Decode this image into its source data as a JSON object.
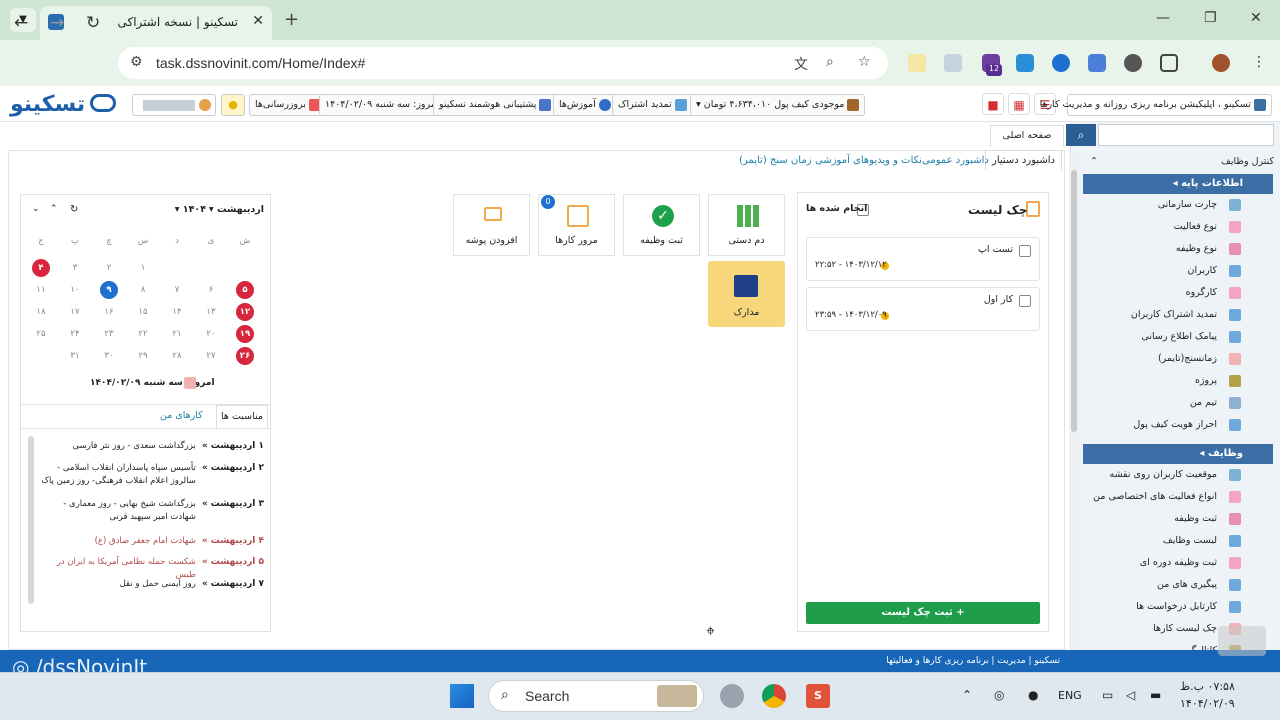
{
  "browser": {
    "tab_title": "تسکینو | نسخه اشتراکی",
    "url": "task.dssnovinit.com/Home/Index#",
    "ext_badge": "12"
  },
  "app": {
    "logo": "تسکینو",
    "chips": {
      "wallet": "موجودی کیف پول ۴،۶۳۴،۰۱۰ تومان",
      "renew": "تمدید اشتراک",
      "tutorials": "آموزش‌ها",
      "support": "پشتیبانی هوشمند تسکینو",
      "today": "امروز: سه شنبه ۱۴۰۴/۰۲/۰۹",
      "updates": "بروزرسانی‌ها"
    },
    "app_title": "تسکینو ، اپلیکیشن برنامه ریزی روزانه و مدیریت کارها",
    "breadcrumb": "صفحه اصلی",
    "tabs": [
      "داشبورد دستیار",
      "داشبورد عمومی",
      "نکات و ویدیوهای آموزشی",
      "زمان سنج (تایمر)"
    ]
  },
  "sidebar": {
    "title": "کنترل وظایف",
    "section1": "اطلاعات پایه",
    "items1": [
      "چارت سازمانی",
      "نوع فعالیت",
      "نوع وظیفه",
      "کاربران",
      "کارگروه",
      "تمدید اشتراک کاربران",
      "پیامک اطلاع رسانی",
      "زمانسنج(تایمر)",
      "پروژه",
      "تیم من",
      "احراز هویت کیف پول"
    ],
    "section2": "وظایف",
    "items2": [
      "موقعیت کاربران روی نقشه",
      "انواع فعالیت های اختصاصی من",
      "ثبت وظیفه",
      "لیست وظایف",
      "ثبت وظیفه دوره ای",
      "پیگیری های من",
      "کارتابل درخواست ها",
      "چک لیست کارها",
      "کاتالوگ"
    ]
  },
  "checklist": {
    "title": "چک لیست",
    "done_label": "انجام شده ها",
    "items": [
      {
        "title": "تست اپ",
        "date": "۱۴۰۳/۱۲/۱۲ - ۲۲:۵۲"
      },
      {
        "title": "کار اول",
        "date": "۱۴۰۳/۱۲/۰۹ - ۲۳:۵۹"
      }
    ],
    "add_button": "+ ثبت چک لیست"
  },
  "tiles": {
    "dam_dasti": "دم دستی",
    "sabt": "ثبت وظیفه",
    "morur": "مرور کارها",
    "morur_badge": "0",
    "folder": "افزودن پوشه",
    "docs": "مدارک"
  },
  "calendar": {
    "month": "اردیبهشت",
    "year": "۱۴۰۴",
    "weekdays": [
      "ش",
      "ی",
      "د",
      "س",
      "چ",
      "پ",
      "ج"
    ],
    "days": [
      "",
      "",
      "",
      "۱",
      "۲",
      "۳",
      "۴",
      "۵",
      "۶",
      "۷",
      "۸",
      "۹",
      "۱۰",
      "۱۱",
      "۱۲",
      "۱۳",
      "۱۴",
      "۱۵",
      "۱۶",
      "۱۷",
      "۱۸",
      "۱۹",
      "۲۰",
      "۲۱",
      "۲۲",
      "۲۳",
      "۲۴",
      "۲۵",
      "۲۶",
      "۲۷",
      "۲۸",
      "۲۹",
      "۳۰",
      "۳۱"
    ],
    "holidays": [
      "۴",
      "۵",
      "۱۲",
      "۱۹",
      "۲۶"
    ],
    "selected": "۹",
    "today": "امروز: سه شنبه ۱۴۰۴/۰۲/۰۹",
    "tab_events": "مناسبت ها",
    "tab_mywork": "کارهای من",
    "events": [
      {
        "day": "۱ اردیبهشت »",
        "text": "بزرگداشت سعدی - روز نثر فارسی",
        "red": false
      },
      {
        "day": "۲ اردیبهشت »",
        "text": "تأسیس سپاه پاسداران انقلاب اسلامی - سالروز اعلام انقلاب فرهنگی- روز زمین پاک",
        "red": false
      },
      {
        "day": "۳ اردیبهشت »",
        "text": "بزرگداشت شیخ بهایی - روز معماری - شهادت امیر سپهبد قرنی",
        "red": false
      },
      {
        "day": "۴ اردیبهشت »",
        "text": "شهادت امام جعفر صادق (ع)",
        "red": true
      },
      {
        "day": "۵ اردیبهشت »",
        "text": "شکست حمله نظامی آمریکا به ایران در طبس",
        "red": true
      },
      {
        "day": "۷ اردیبهشت »",
        "text": "روز ایمنی حمل و نقل",
        "red": false
      }
    ]
  },
  "footer": "تسکینو | مدیریت | برنامه ریزی کارها و فعالیتها",
  "watermark": "/dssNovinIt",
  "taskbar": {
    "search": "Search",
    "lang": "ENG",
    "time": "۰۷:۵۸ ب.ظ",
    "date": "۱۴۰۴/۰۲/۰۹"
  }
}
